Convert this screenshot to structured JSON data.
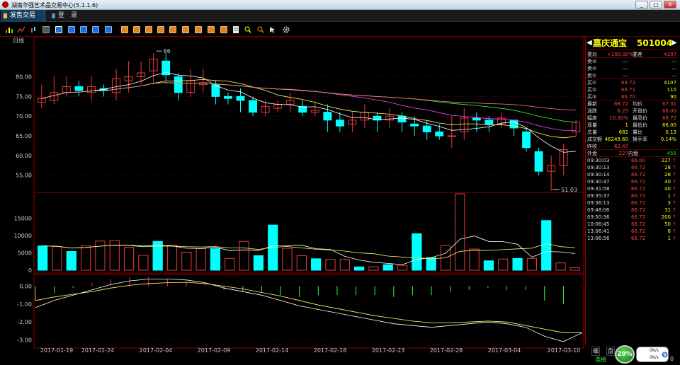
{
  "window": {
    "title": "湖南华强艺术品交易中心(5.1.1.6)",
    "buttons": [
      "_",
      "□",
      "X"
    ]
  },
  "menu": {
    "trade": "发售交易",
    "login": "登　录"
  },
  "toolbar": {
    "icons": [
      "bar-chart-icon",
      "line-chart-icon",
      "candles-icon",
      "calendar-icon",
      "grid-icon",
      "blue-square-icon",
      "blue-square-icon",
      "blue-square-icon",
      "blue-square-icon",
      "orange-square-icon",
      "orange-square-icon",
      "orange-square-icon",
      "orange-square-icon",
      "orange-square-icon",
      "orange-square-icon",
      "orange-square-icon",
      "orange-square-icon",
      "orange-square-icon",
      "zoom-in-icon",
      "zoom-out-icon",
      "settings-gear-icon"
    ]
  },
  "chart": {
    "period_label": "日线",
    "price_axis": [
      "80.00",
      "75.00",
      "70.00",
      "65.00",
      "60.00",
      "55.00"
    ],
    "vol_axis": [
      "15000",
      "10000",
      "5000",
      "0"
    ],
    "macd_axis": [
      "0.00",
      "-1.00",
      "-2.00",
      "-3.00"
    ],
    "date_axis": [
      "2017-01-19",
      "2017-01-24",
      "2017-02-04",
      "2017-02-09",
      "2017-02-14",
      "2017-02-18",
      "2017-02-23",
      "2017-02-28",
      "2017-03-04",
      "2017-03-10"
    ],
    "max_label": "86",
    "min_label": "51.03",
    "colors": {
      "up": "#e83b3b",
      "down": "#00ffff",
      "grid": "#8b0000",
      "ma5": "#ffffff",
      "ma10": "#ffff66",
      "ma20": "#ff44ff",
      "ma30": "#33ff33",
      "ma60": "#ff8080"
    }
  },
  "chart_data": {
    "type": "candlestick",
    "ylim": [
      51,
      88
    ],
    "candles": [
      [
        73.5,
        74.5,
        78,
        72
      ],
      [
        74,
        76,
        80,
        73
      ],
      [
        76,
        77.5,
        80,
        75
      ],
      [
        77.5,
        76.5,
        79,
        75
      ],
      [
        76,
        77.5,
        80,
        74
      ],
      [
        77,
        76.5,
        78,
        75
      ],
      [
        76,
        79.5,
        82,
        74
      ],
      [
        79,
        80,
        84,
        76
      ],
      [
        80,
        81,
        84,
        78
      ],
      [
        81.5,
        84.5,
        86,
        78
      ],
      [
        84,
        80.5,
        86,
        79
      ],
      [
        80,
        76,
        81,
        74
      ],
      [
        76,
        79,
        82,
        75
      ],
      [
        78,
        78.5,
        82,
        76
      ],
      [
        78,
        75,
        79,
        73
      ],
      [
        75,
        74.5,
        76,
        73
      ],
      [
        75,
        74,
        77,
        71
      ],
      [
        74,
        71,
        75,
        70
      ],
      [
        71,
        72.5,
        74,
        70
      ],
      [
        72,
        73,
        74,
        71
      ],
      [
        73,
        74,
        76,
        71
      ],
      [
        72.5,
        71,
        74,
        70
      ],
      [
        71,
        71.5,
        74,
        70
      ],
      [
        71,
        69,
        73,
        66
      ],
      [
        69,
        67.5,
        71,
        66
      ],
      [
        68,
        69,
        71,
        66
      ],
      [
        69,
        71,
        73,
        67
      ],
      [
        70,
        69,
        71,
        66
      ],
      [
        69,
        70,
        72,
        67
      ],
      [
        70,
        68.5,
        71,
        66
      ],
      [
        68,
        67.5,
        70,
        65
      ],
      [
        67.5,
        66,
        69,
        64
      ],
      [
        66,
        65,
        68,
        64
      ],
      [
        65,
        65,
        70,
        62
      ],
      [
        66,
        69.5,
        72,
        64
      ],
      [
        69.5,
        69,
        71,
        66
      ],
      [
        69,
        68,
        70,
        66
      ],
      [
        68,
        69.5,
        71,
        67
      ],
      [
        69,
        67,
        69,
        65
      ],
      [
        66,
        62,
        67,
        61
      ],
      [
        61,
        56,
        62,
        55
      ],
      [
        56,
        57.5,
        60,
        51
      ],
      [
        57.5,
        61.5,
        63,
        55
      ],
      [
        66,
        68.5,
        69,
        65
      ]
    ],
    "volume": [
      7000,
      6800,
      5400,
      7000,
      8400,
      8500,
      6600,
      4300,
      8300,
      7200,
      5200,
      6200,
      6200,
      3400,
      8300,
      4200,
      13000,
      6300,
      4200,
      3300,
      3100,
      3100,
      950,
      1000,
      1600,
      1400,
      10500,
      3600,
      7100,
      22000,
      6100,
      2700,
      3200,
      3400,
      3400,
      14300,
      2100,
      720
    ],
    "macd_dif": [
      -1.2,
      -0.8,
      -0.5,
      -0.2,
      0.1,
      0.3,
      0.4,
      0.4,
      0.35,
      0.2,
      -0.1,
      -0.3,
      -0.5,
      -0.8,
      -1.1,
      -1.3,
      -1.5,
      -1.7,
      -1.9,
      -2.1,
      -2.2,
      -2.3,
      -2.2,
      -2.1,
      -2.0,
      -2.1,
      -2.3,
      -2.8,
      -3.1,
      -2.6
    ],
    "macd_dea": [
      -0.8,
      -0.6,
      -0.45,
      -0.3,
      -0.1,
      0.05,
      0.15,
      0.2,
      0.22,
      0.15,
      0,
      -0.15,
      -0.35,
      -0.55,
      -0.8,
      -1.05,
      -1.25,
      -1.45,
      -1.65,
      -1.8,
      -1.95,
      -2.05,
      -2.05,
      -2.0,
      -1.95,
      -2.0,
      -2.2,
      -2.4,
      -2.6,
      -2.6
    ]
  },
  "panel": {
    "name": "嘉庆通宝",
    "code": "501004",
    "webi": {
      "k1": "委比",
      "v1": "+100.00%",
      "k2": "委差",
      "v2": "4307"
    },
    "asks": [
      [
        "卖③",
        "—",
        "—"
      ],
      [
        "卖②",
        "—",
        "—"
      ],
      [
        "卖①",
        "—",
        "—"
      ]
    ],
    "bids": [
      [
        "买①",
        "66.72",
        "4107"
      ],
      [
        "买②",
        "66.71",
        "110"
      ],
      [
        "买③",
        "66.70",
        "90"
      ]
    ],
    "quotes": [
      [
        "最新",
        "68.72",
        "均价",
        "67.31"
      ],
      [
        "涨跌",
        "6.25",
        "开盘价",
        "66.00"
      ],
      [
        "幅度",
        "10.00%",
        "最高价",
        "68.72"
      ],
      [
        "现量",
        "1",
        "最低价",
        "66.00"
      ],
      [
        "总量",
        "682",
        "量比",
        "0.13"
      ],
      [
        "成交额",
        "46249.60",
        "换手率",
        "0.14%"
      ],
      [
        "昨收",
        "62.47",
        "",
        ""
      ]
    ],
    "outer": {
      "k1": "外盘",
      "v1": "227",
      "k2": "内盘",
      "v2": "455"
    },
    "ticks": [
      [
        "09:30:03",
        "66.00",
        "227"
      ],
      [
        "09:30:13",
        "66.72",
        "28"
      ],
      [
        "09:30:14",
        "66.72",
        "28"
      ],
      [
        "09:30:37",
        "66.72",
        "40"
      ],
      [
        "09:31:58",
        "66.72",
        "40"
      ],
      [
        "09:35:37",
        "66.72",
        "1"
      ],
      [
        "09:36:13",
        "66.72",
        "3"
      ],
      [
        "09:48:06",
        "66.72",
        "31"
      ],
      [
        "09:50:36",
        "66.72",
        "200"
      ],
      [
        "10:06:45",
        "66.72",
        "50"
      ],
      [
        "13:06:41",
        "66.72",
        "6"
      ],
      [
        "13:06:56",
        "66.72",
        "1"
      ]
    ],
    "tabs": [
      "细",
      "盘"
    ],
    "status": "连接",
    "status_suffix": "0"
  },
  "widget": {
    "percent": "29%",
    "up": "0K/s",
    "down": "0K/s"
  }
}
